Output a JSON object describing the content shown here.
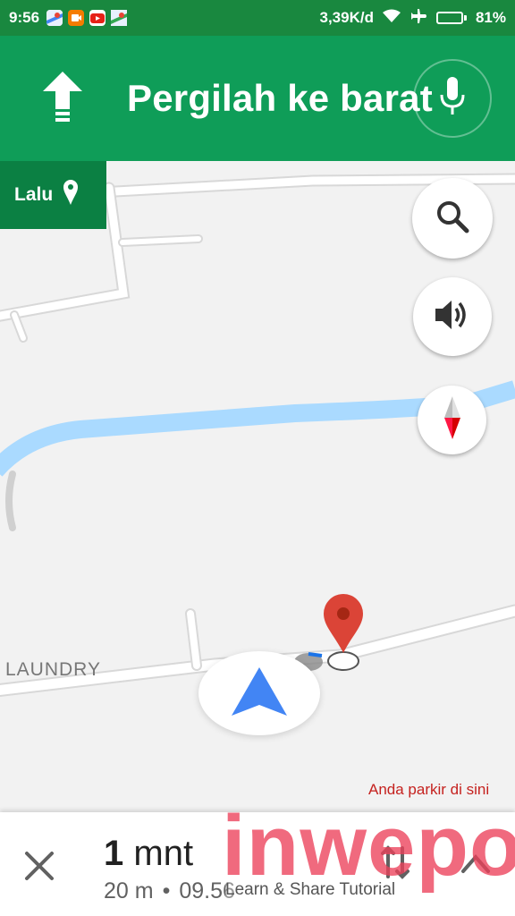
{
  "status_bar": {
    "time": "9:56",
    "network_speed": "3,39K/d",
    "battery_percent": "81%",
    "battery_level": 0.81,
    "icons": [
      "maps-app-icon",
      "cam-app-icon",
      "youtube-app-icon",
      "maps-app-icon",
      "wifi-icon",
      "airplane-icon"
    ]
  },
  "navigation": {
    "instruction": "Pergilah ke barat",
    "direction_icon": "arrow-up-icon",
    "mic_icon": "mic-icon"
  },
  "then_chip": {
    "label": "Lalu",
    "icon": "place-pin-icon"
  },
  "map": {
    "poi_label": "LAUNDRY",
    "parking_label": "Anda parkir di sini",
    "buttons": [
      "search-icon",
      "volume-icon",
      "compass-icon"
    ],
    "colors": {
      "header": "#0f9d58",
      "status_bar": "#19883f",
      "then_chip": "#0b8043",
      "water": "#aadaff",
      "parking_pin": "#db4437",
      "navigation_arrow": "#4285f4"
    }
  },
  "bottom": {
    "eta_number": "1",
    "eta_unit": "mnt",
    "distance": "20 m",
    "separator": "•",
    "arrival": "09.56"
  },
  "watermark": {
    "text": "inwepo",
    "subtitle": "Learn & Share Tutorial"
  }
}
